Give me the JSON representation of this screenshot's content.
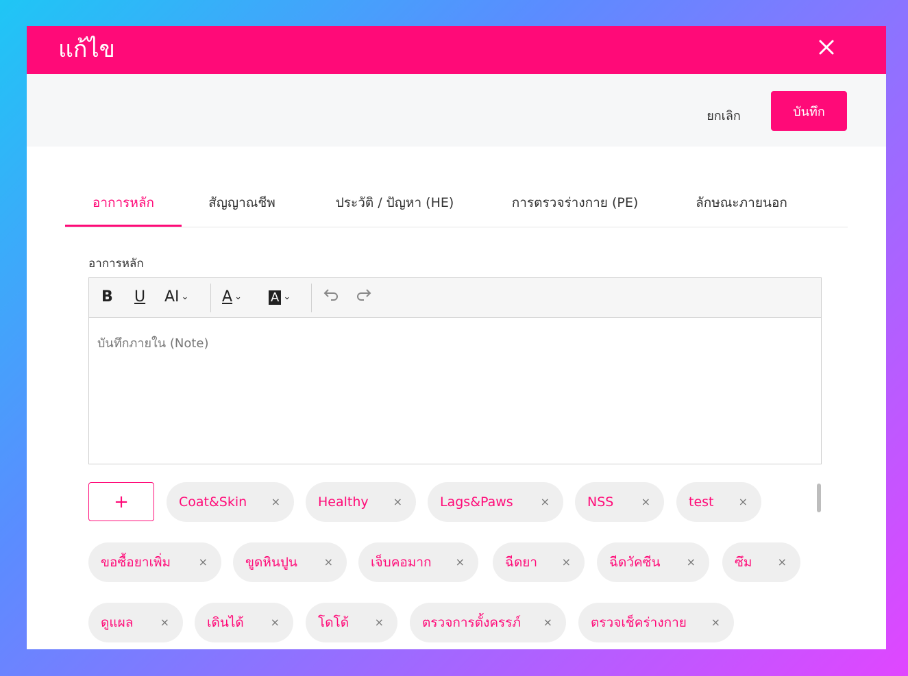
{
  "dialog": {
    "title": "แก้ไข",
    "close_icon": "close-icon",
    "cancel_label": "ยกเลิก",
    "save_label": "บันทึก"
  },
  "tabs": [
    {
      "label": "อาการหลัก",
      "active": true
    },
    {
      "label": "สัญญาณชีพ",
      "active": false
    },
    {
      "label": "ประวัติ / ปัญหา (HE)",
      "active": false
    },
    {
      "label": "การตรวจร่างกาย (PE)",
      "active": false
    },
    {
      "label": "ลักษณะภายนอก",
      "active": false
    }
  ],
  "field": {
    "label": "อาการหลัก",
    "placeholder": "บันทึกภายใน (Note)",
    "value": ""
  },
  "toolbar": {
    "bold": "B",
    "underline": "U",
    "font_size": "AI",
    "font_color": "A",
    "highlight": "A",
    "undo_icon": "undo-icon",
    "redo_icon": "redo-icon"
  },
  "chips": {
    "add_label": "+",
    "items": [
      "Coat&Skin",
      "Healthy",
      "Lags&Paws",
      "NSS",
      "test",
      "ขอซื้อยาเพิ่ม",
      "ขูดหินปูน",
      "เจ็บคอมาก",
      "ฉีดยา",
      "ฉีดวัคซีน",
      "ซึม",
      "ดูแผล",
      "เดินได้",
      "โดโด้",
      "ตรวจการตั้งครรภ์",
      "ตรวจเช็คร่างกาย"
    ],
    "remove_symbol": "×"
  },
  "colors": {
    "accent": "#ff0a78",
    "chip_bg": "#efefef",
    "action_bar_bg": "#f6f7f8"
  }
}
